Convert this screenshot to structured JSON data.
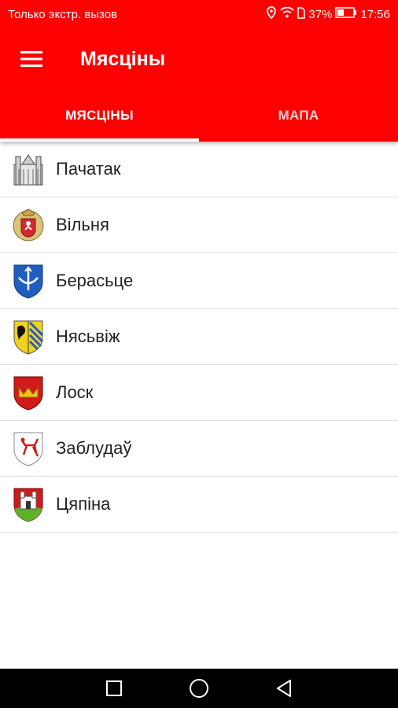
{
  "status_bar": {
    "carrier_text": "Только экстр. вызов",
    "battery_percent": "37%",
    "time": "17:56",
    "icons": [
      "location-icon",
      "wifi-icon",
      "sim-icon",
      "battery-icon"
    ]
  },
  "app_bar": {
    "title": "Мясціны",
    "menu_icon": "hamburger-menu-icon"
  },
  "tabs": [
    {
      "label": "МЯСЦІНЫ",
      "selected": true
    },
    {
      "label": "МАПА",
      "selected": false
    }
  ],
  "places": [
    {
      "label": "Пачатак",
      "icon": "cathedral-sketch-icon"
    },
    {
      "label": "Вільня",
      "icon": "vilnius-coat-of-arms-icon"
    },
    {
      "label": "Берасьце",
      "icon": "brest-coat-of-arms-icon"
    },
    {
      "label": "Нясьвіж",
      "icon": "nesvizh-coat-of-arms-icon"
    },
    {
      "label": "Лоск",
      "icon": "losk-coat-of-arms-icon"
    },
    {
      "label": "Заблудаў",
      "icon": "zabludow-coat-of-arms-icon"
    },
    {
      "label": "Цяпіна",
      "icon": "tsiapina-coat-of-arms-icon"
    }
  ],
  "colors": {
    "primary": "#ff0000",
    "navbar": "#000000"
  },
  "nav_bar": {
    "icons": [
      "recents-square-icon",
      "home-circle-icon",
      "back-triangle-icon"
    ]
  }
}
